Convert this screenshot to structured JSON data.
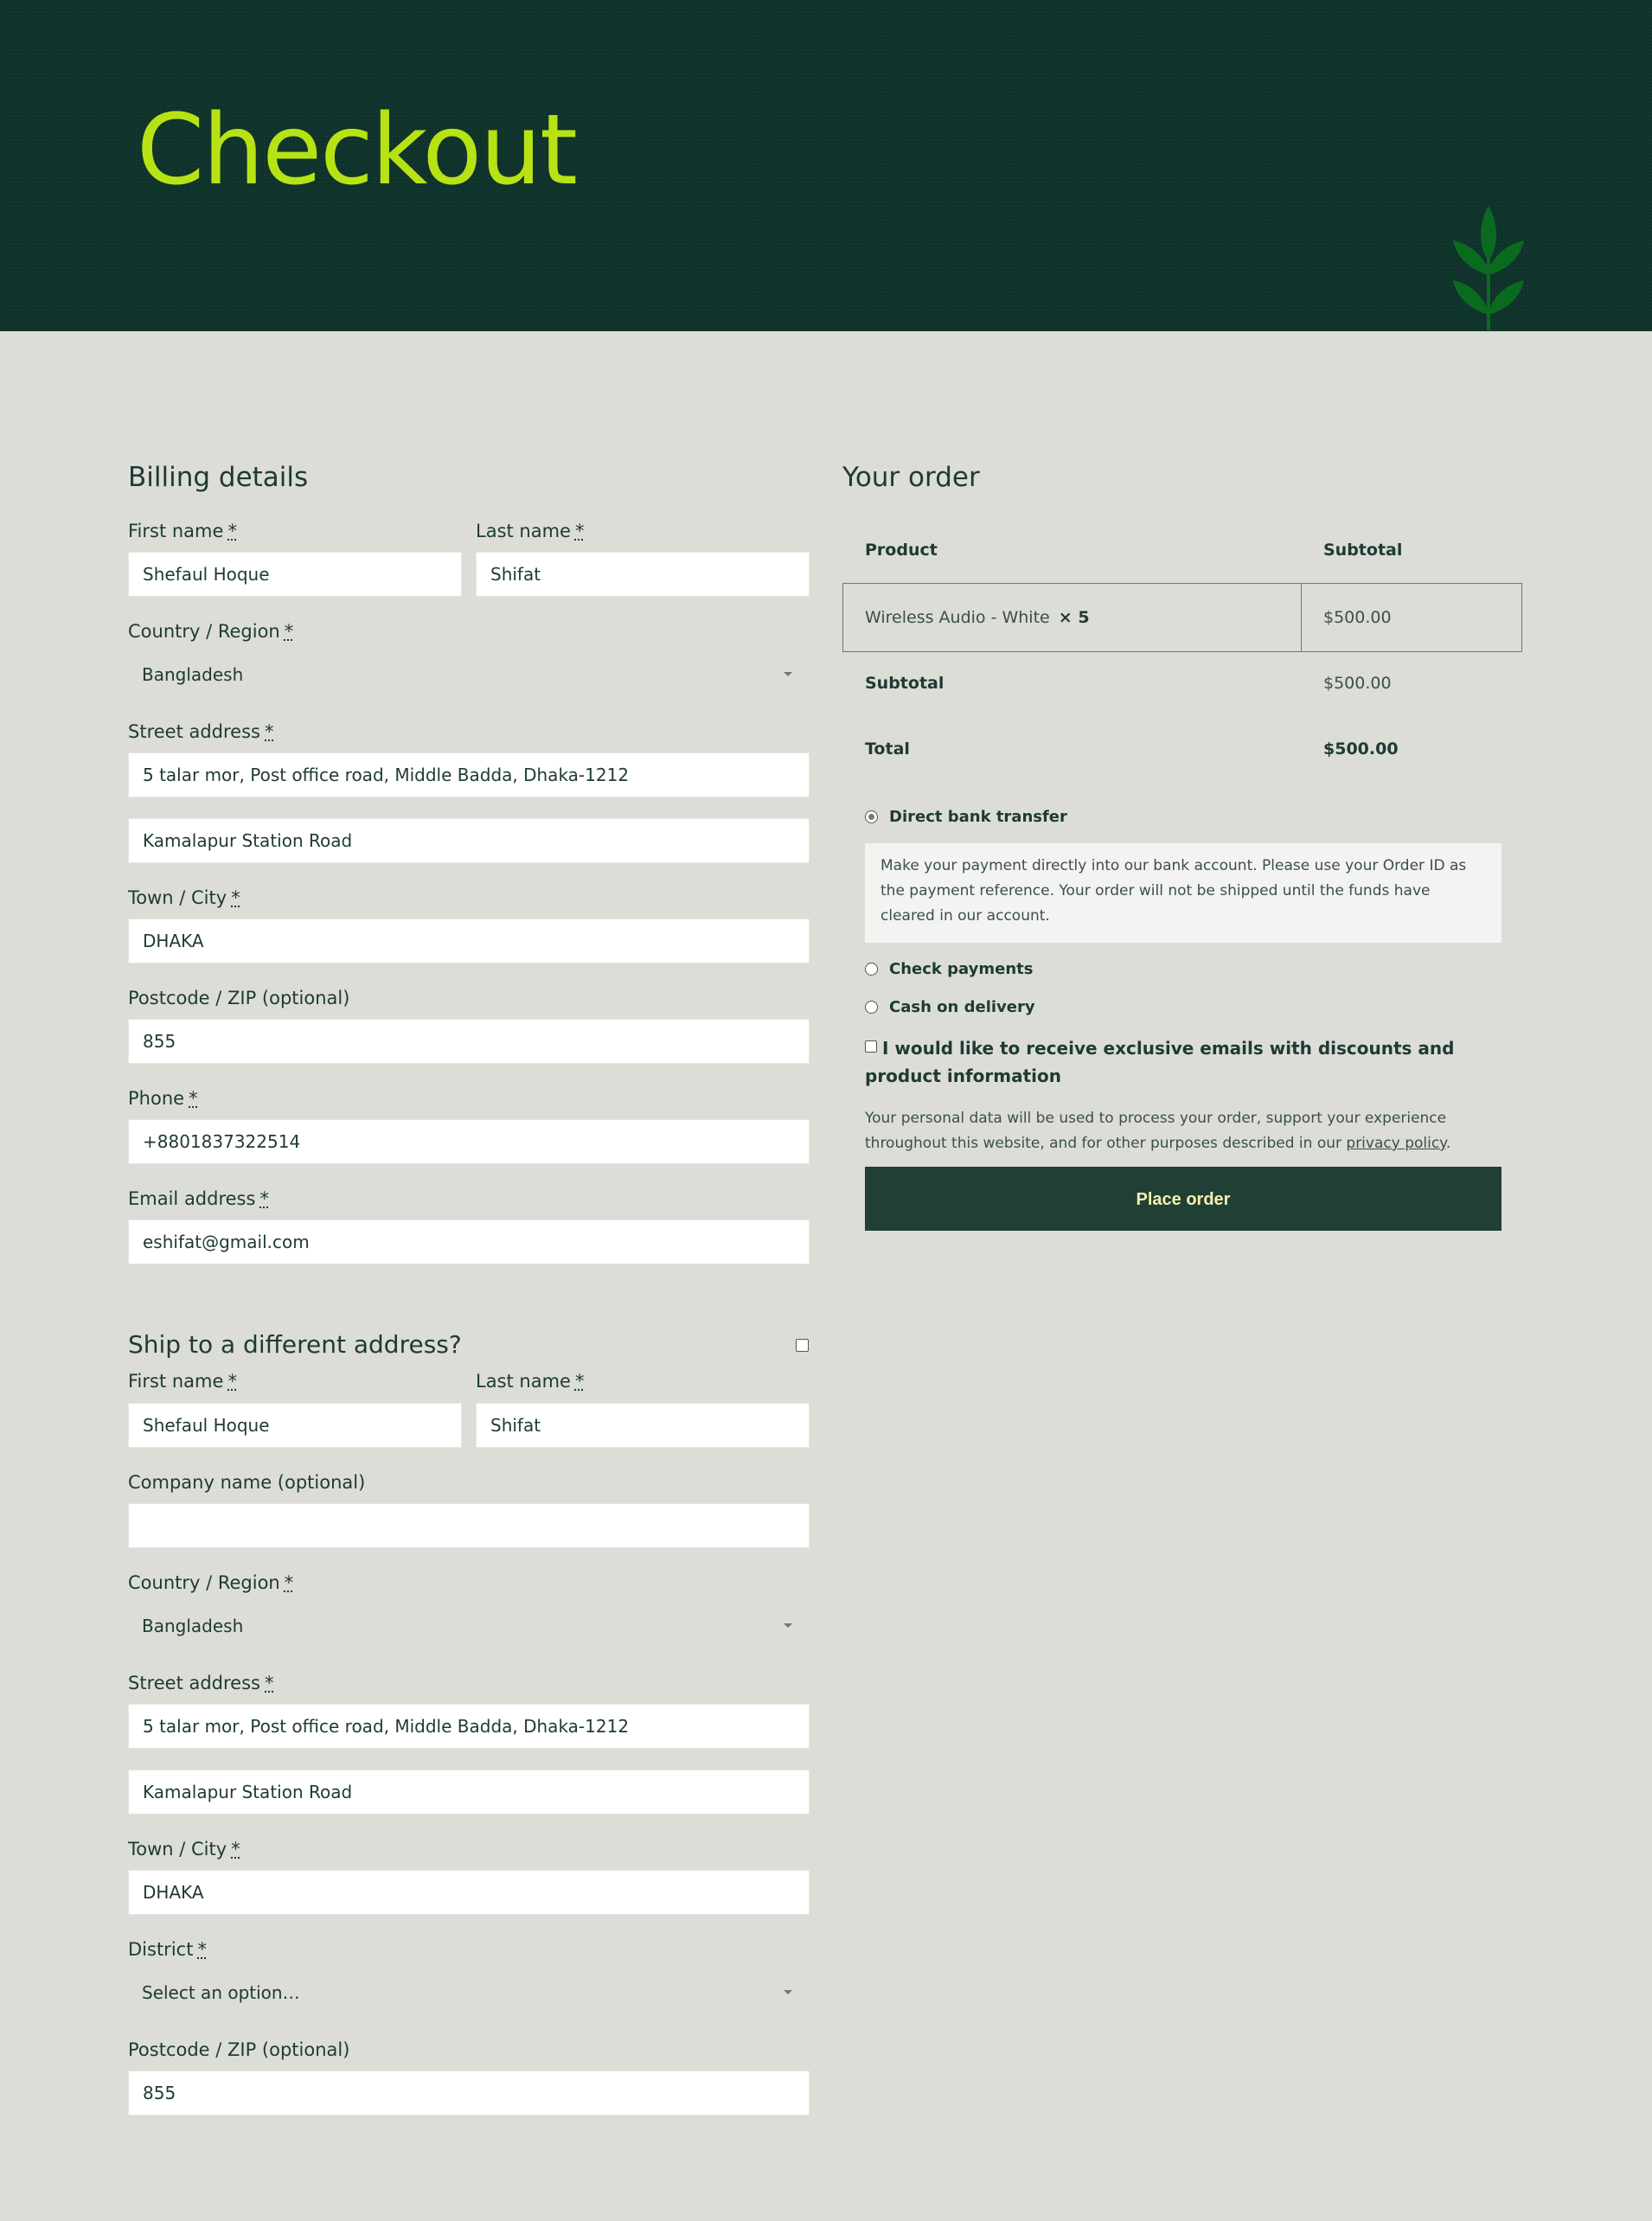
{
  "page_title": "Checkout",
  "billing": {
    "title": "Billing details",
    "first_name_label": "First name",
    "first_name_value": "Shefaul Hoque",
    "last_name_label": "Last name",
    "last_name_value": "Shifat",
    "country_label": "Country / Region",
    "country_value": "Bangladesh",
    "street_label": "Street address",
    "street_value_1": "5 talar mor, Post office road, Middle Badda, Dhaka-1212",
    "street_value_2": "Kamalapur Station Road",
    "city_label": "Town / City",
    "city_value": "DHAKA",
    "postcode_label": "Postcode / ZIP (optional)",
    "postcode_value": "855",
    "phone_label": "Phone",
    "phone_value": "+8801837322514",
    "email_label": "Email address",
    "email_value": "eshifat@gmail.com"
  },
  "shipping": {
    "title": "Ship to a different address?",
    "first_name_label": "First name",
    "first_name_value": "Shefaul Hoque",
    "last_name_label": "Last name",
    "last_name_value": "Shifat",
    "company_label": "Company name (optional)",
    "company_value": "",
    "country_label": "Country / Region",
    "country_value": "Bangladesh",
    "street_label": "Street address",
    "street_value_1": "5 talar mor, Post office road, Middle Badda, Dhaka-1212",
    "street_value_2": "Kamalapur Station Road",
    "city_label": "Town / City",
    "city_value": "DHAKA",
    "district_label": "District",
    "district_value": "Select an option…",
    "postcode_label": "Postcode / ZIP (optional)",
    "postcode_value": "855"
  },
  "required_mark": "*",
  "order": {
    "title": "Your order",
    "col_product": "Product",
    "col_subtotal": "Subtotal",
    "item_name": "Wireless Audio - White",
    "item_qty": "× 5",
    "item_price": "$500.00",
    "subtotal_label": "Subtotal",
    "subtotal_value": "$500.00",
    "total_label": "Total",
    "total_value": "$500.00"
  },
  "payment": {
    "bank_label": "Direct bank transfer",
    "bank_description": "Make your payment directly into our bank account. Please use your Order ID as the payment reference. Your order will not be shipped until the funds have cleared in our account.",
    "check_label": "Check payments",
    "cod_label": "Cash on delivery",
    "selected": "Direct bank transfer"
  },
  "newsletter_label": "I would like to receive exclusive emails with discounts and product information",
  "privacy_text_before": "Your personal data will be used to process your order, support your experience throughout this website, and for other purposes described in our ",
  "privacy_link": "privacy policy",
  "privacy_text_after": ".",
  "place_order_label": "Place order",
  "colors": {
    "hero_bg": "#0f332b",
    "title_accent": "#b7e315",
    "page_bg": "#dcddd7",
    "button_bg": "#213f35",
    "button_text": "#f5eeb0"
  },
  "icons": {
    "hero_leaf": "leaf-branch-icon",
    "select_caret": "chevron-down-icon"
  }
}
